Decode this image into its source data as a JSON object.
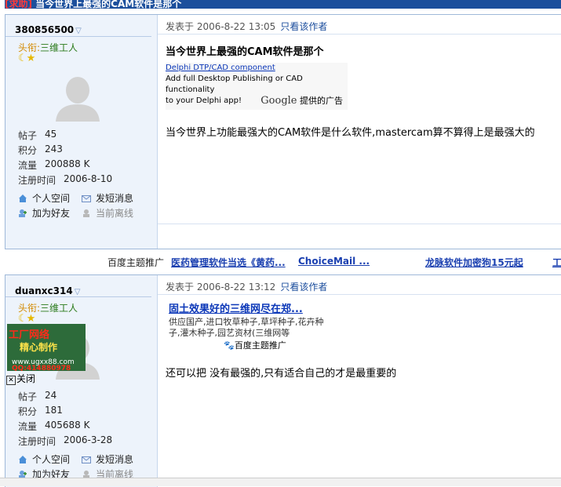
{
  "topic": {
    "tag": "[求助]",
    "title": " 当今世界上最强的CAM软件是那个"
  },
  "icons": {
    "home": "home-icon",
    "message": "envelope-icon",
    "friend": "add-friend-icon",
    "status": "person-icon",
    "paw": "paw-icon",
    "close": "close-box-icon"
  },
  "posts": [
    {
      "username": "380856500",
      "rank_label": "头衔:",
      "rank_value": "三维工人",
      "stats": {
        "posts_label": "帖子",
        "posts": "45",
        "points_label": "积分",
        "points": "243",
        "traffic_label": "流量",
        "traffic": "200888 K",
        "reg_label": "注册时间",
        "reg": "2006-8-10"
      },
      "actions": {
        "space": "个人空间",
        "message": "发短消息",
        "friend": "加为好友",
        "status": "当前离线"
      },
      "meta": {
        "posted": "发表于  2006-8-22 13:05",
        "author": "只看该作者"
      },
      "title": "当今世界上最强的CAM软件是那个",
      "ad": {
        "link": "Delphi DTP/CAD component",
        "line1": "Add full Desktop Publishing or CAD functionality",
        "line2": "to your Delphi app!",
        "brand": "Google",
        "brand_suffix": " 提供的广告"
      },
      "body": "当今世界上功能最强大的CAM软件是什么软件,mastercam算不算得上是最强大的"
    },
    {
      "username": "duanxc314",
      "rank_label": "头衔:",
      "rank_value": "三维工人",
      "stats": {
        "posts_label": "帖子",
        "posts": "24",
        "points_label": "积分",
        "points": "181",
        "traffic_label": "流量",
        "traffic": "405688 K",
        "reg_label": "注册时间",
        "reg": "2006-3-28"
      },
      "actions": {
        "space": "个人空间",
        "message": "发短消息",
        "friend": "加为好友",
        "status": "当前离线"
      },
      "meta": {
        "posted": "发表于  2006-8-22 13:12",
        "author": "只看该作者"
      },
      "ad": {
        "headline": "固土效果好的三维网尽在郑...",
        "line1": "供应国产,进口牧草种子,草坪种子,花卉种",
        "line2": "子,灌木种子,园艺资材(三维网等",
        "badge": "百度主题推广"
      },
      "body": "还可以把  没有最强的,只有适合自己的才是最重要的"
    }
  ],
  "promo_bar": {
    "label": "百度主题推广",
    "links": [
      "医药管理软件当选《黄药...",
      "ChoiceMail ...",
      "龙脉软件加密狗15元起",
      "工"
    ]
  },
  "float_ad": {
    "line1": "工厂网络",
    "line2": "精心制作",
    "line3": "www.ugxx88.com",
    "line4": "QQ:414880978",
    "close": "关闭"
  }
}
